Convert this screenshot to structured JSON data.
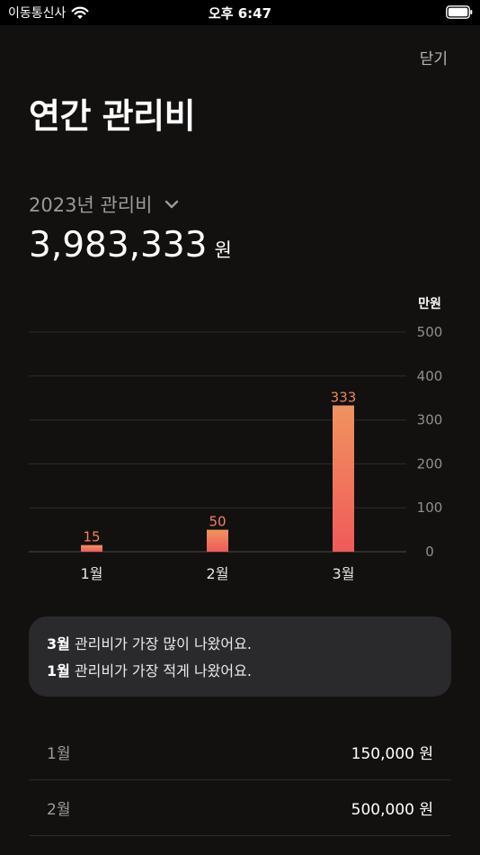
{
  "status_bar": {
    "carrier": "이동통신사",
    "time": "오후 6:47"
  },
  "header": {
    "close_label": "닫기",
    "title": "연간 관리비"
  },
  "summary": {
    "year_label": "2023년 관리비",
    "total_amount": "3,983,333",
    "unit": "원"
  },
  "chart_data": {
    "type": "bar",
    "unit_label": "만원",
    "categories": [
      "1월",
      "2월",
      "3월"
    ],
    "values": [
      15,
      50,
      333
    ],
    "yticks": [
      500,
      400,
      300,
      200,
      100,
      0
    ],
    "ylim": [
      0,
      500
    ],
    "grid": true,
    "colors": {
      "bar_top": "#f0935f",
      "bar_bottom": "#f05a5a",
      "label": "#f2835a"
    }
  },
  "insight": {
    "line1_month": "3월",
    "line1_text": " 관리비가 가장 많이 나왔어요.",
    "line2_month": "1월",
    "line2_text": " 관리비가 가장 적게 나왔어요."
  },
  "months": [
    {
      "name": "1월",
      "amount": "150,000 원"
    },
    {
      "name": "2월",
      "amount": "500,000 원"
    }
  ]
}
